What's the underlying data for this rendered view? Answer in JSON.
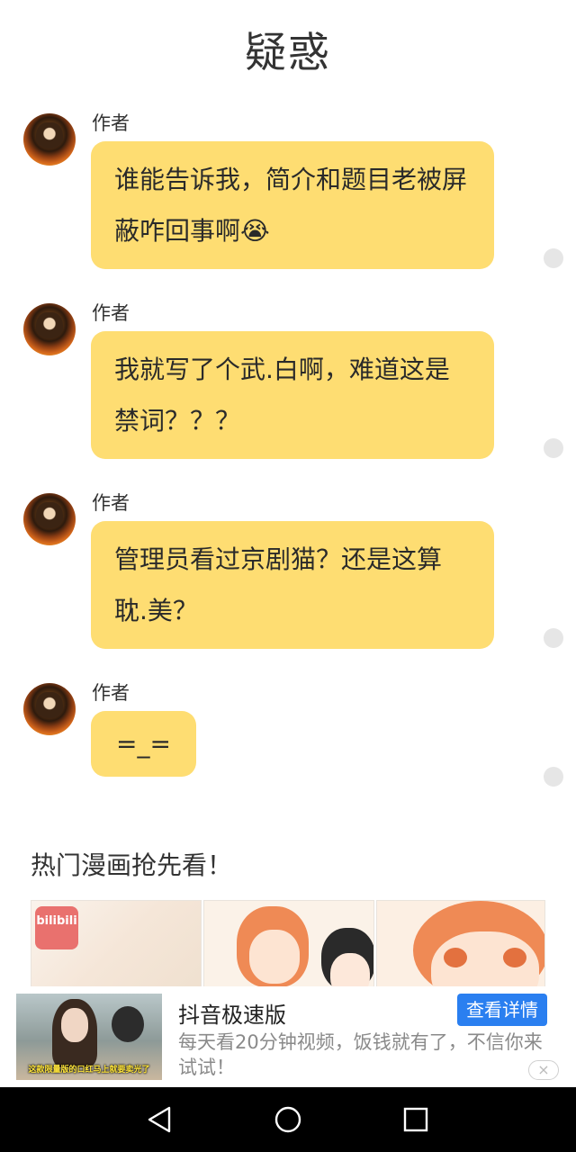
{
  "header": {
    "title": "疑惑"
  },
  "messages": [
    {
      "author": "作者",
      "text": "谁能告诉我，简介和题目老被屏蔽咋回事啊😭"
    },
    {
      "author": "作者",
      "text": "我就写了个武.白啊，难道这是禁词？？？"
    },
    {
      "author": "作者",
      "text": "管理员看过京剧猫？还是这算耽.美？"
    },
    {
      "author": "作者",
      "text": "=_="
    }
  ],
  "hot_section": {
    "title": "热门漫画抢先看！"
  },
  "comics": [
    {
      "logo_text": "bilibili"
    },
    {
      "logo_text": ""
    },
    {
      "logo_text": ""
    }
  ],
  "ad": {
    "title": "抖音极速版",
    "cta": "查看详情",
    "description": "每天看20分钟视频，饭钱就有了，不信你来试试！",
    "thumb_caption": "这款限量版的口红马上就要卖光了",
    "close": "×"
  },
  "colors": {
    "bubble": "#fedd72",
    "cta": "#2a7ff0",
    "navbar": "#000000"
  },
  "icons": [
    "back-icon",
    "home-icon",
    "recent-apps-icon",
    "close-icon"
  ]
}
